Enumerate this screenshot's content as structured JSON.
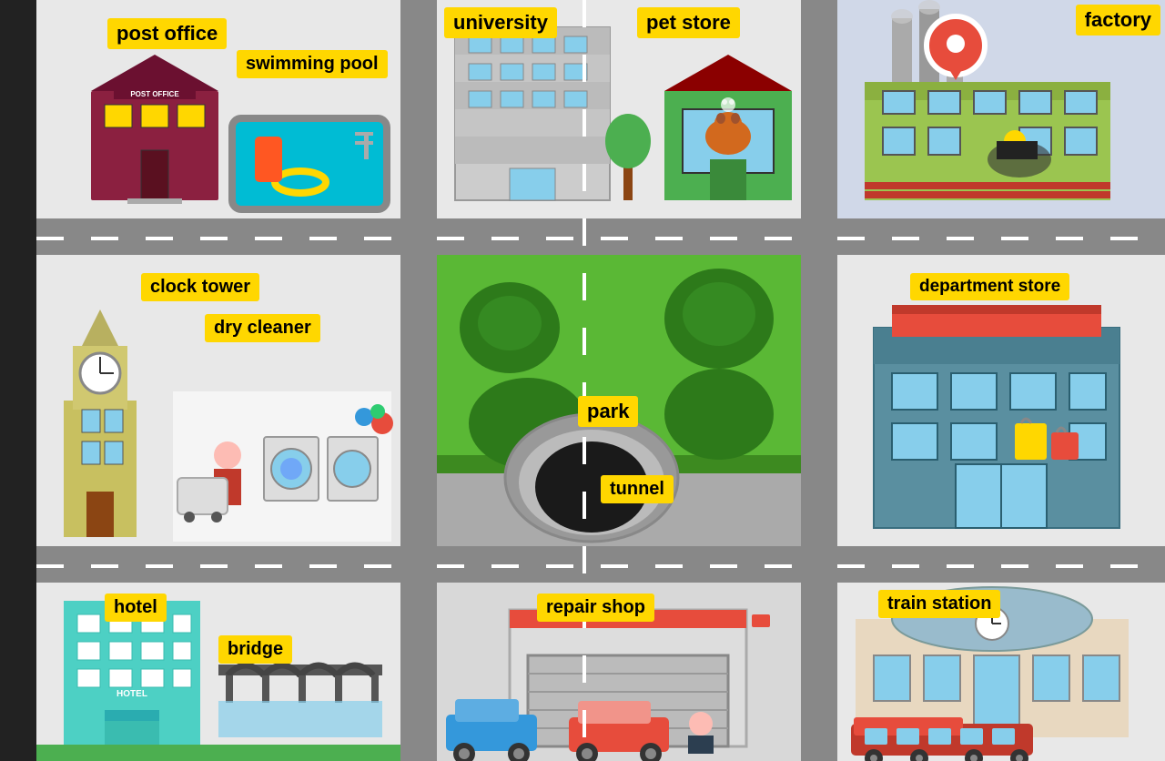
{
  "cells": {
    "post_office": {
      "label1": "post office",
      "label2": "swimming pool",
      "label1_top": "20px",
      "label1_left": "80px",
      "label2_top": "50px",
      "label2_left": "220px"
    },
    "university": {
      "label1": "university",
      "label2": "pet store",
      "label1_top": "10px",
      "label1_left": "10px",
      "label2_top": "10px",
      "label2_left": "215px"
    },
    "factory": {
      "label": "factory",
      "label_top": "5px",
      "label_right": "10px"
    },
    "clock_tower": {
      "label1": "clock tower",
      "label2": "dry cleaner",
      "label1_top": "20px",
      "label1_left": "120px",
      "label2_top": "65px",
      "label2_left": "190px"
    },
    "park": {
      "label1": "park",
      "label2": "tunnel",
      "label1_top": "155px",
      "label1_left": "155px",
      "label2_top": "230px",
      "label2_left": "170px"
    },
    "dept_store": {
      "label": "department store",
      "label_top": "20px",
      "label_left": "80px"
    },
    "hotel": {
      "label1": "hotel",
      "label2": "bridge",
      "label1_top": "15px",
      "label1_left": "80px",
      "label2_top": "60px",
      "label2_left": "200px"
    },
    "repair": {
      "label": "repair shop",
      "label_top": "15px",
      "label_left": "120px"
    },
    "train": {
      "label": "train station",
      "label_top": "10px",
      "label_left": "50px"
    }
  },
  "colors": {
    "road": "#888888",
    "label_bg": "#FFD700",
    "label_text": "#000000"
  }
}
